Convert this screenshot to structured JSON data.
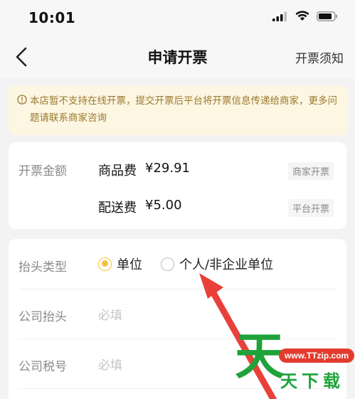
{
  "status_bar": {
    "time": "10:01"
  },
  "nav": {
    "title": "申请开票",
    "right_link": "开票须知"
  },
  "notice": {
    "text": "本店暂不支持在线开票，提交开票后平台将开票信息传递给商家，更多问题请联系商家咨询"
  },
  "amount_section": {
    "label": "开票金额",
    "items": [
      {
        "name": "商品费",
        "value": "¥29.91",
        "tag": "商家开票"
      },
      {
        "name": "配送费",
        "value": "¥5.00",
        "tag": "平台开票"
      }
    ]
  },
  "title_section": {
    "type_label": "抬头类型",
    "options": [
      {
        "label": "单位",
        "selected": true
      },
      {
        "label": "个人/非企业单位",
        "selected": false
      }
    ],
    "company_title": {
      "label": "公司抬头",
      "placeholder": "必填"
    },
    "tax_id": {
      "label": "公司税号",
      "placeholder": "必填"
    }
  },
  "watermark": {
    "big": "天",
    "url": "www.TTzip.com",
    "text": "天下载"
  },
  "colors": {
    "accent": "#f5c13a",
    "notice_bg": "#fdf6e3",
    "notice_text": "#9a7a2e",
    "arrow": "#e8413a",
    "watermark_green": "#1fa23a"
  }
}
